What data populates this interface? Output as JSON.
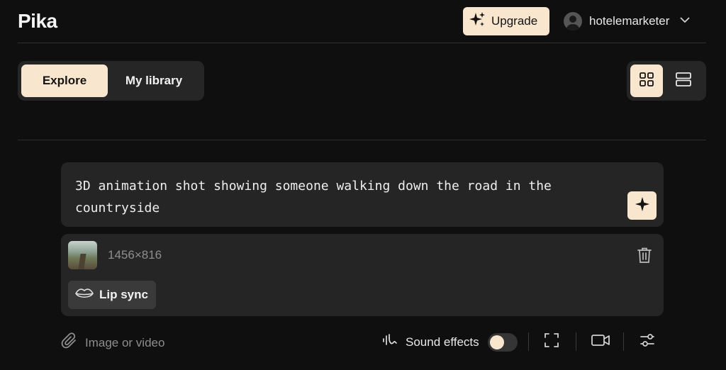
{
  "app": {
    "logo": "Pika"
  },
  "header": {
    "upgrade_label": "Upgrade",
    "username": "hotelemarketer"
  },
  "tabs": [
    {
      "label": "Explore",
      "active": true
    },
    {
      "label": "My library",
      "active": false
    }
  ],
  "view_toggle": {
    "selected": "grid"
  },
  "prompt": {
    "text": "3D animation shot showing someone walking down the road in the countryside"
  },
  "media": {
    "dimensions": "1456×816",
    "lip_sync_label": "Lip sync"
  },
  "toolbar": {
    "attach_label": "Image or video",
    "sound_effects_label": "Sound effects",
    "sound_effects_on": false
  },
  "colors": {
    "accent": "#f9e6cf",
    "background": "#0f0f0f",
    "panel": "#252525"
  }
}
